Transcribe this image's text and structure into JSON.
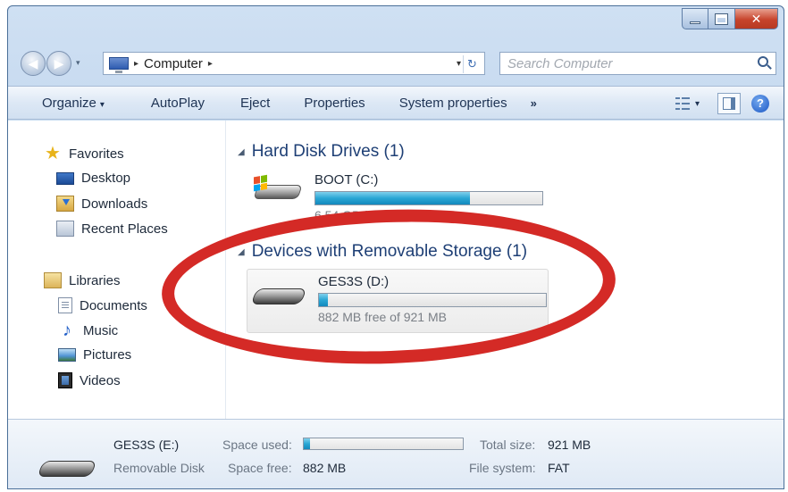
{
  "window": {
    "caption_min": "–",
    "caption_max": "□",
    "caption_close": "✕"
  },
  "address_bar": {
    "separator": "▸",
    "location": "Computer",
    "trailing_separator": "▸",
    "dropdown_glyph": "▾",
    "refresh_glyph": "↻"
  },
  "search": {
    "placeholder": "Search Computer"
  },
  "toolbar": {
    "organize": "Organize",
    "autoplay": "AutoPlay",
    "eject": "Eject",
    "properties": "Properties",
    "system_properties": "System properties",
    "more": "»",
    "dropdown_glyph": "▾",
    "help": "?"
  },
  "sidebar": {
    "favorites": "Favorites",
    "desktop": "Desktop",
    "downloads": "Downloads",
    "recent_places": "Recent Places",
    "libraries": "Libraries",
    "documents": "Documents",
    "music": "Music",
    "pictures": "Pictures",
    "videos": "Videos"
  },
  "main": {
    "hdd_group": "Hard Disk Drives (1)",
    "removable_group": "Devices with Removable Storage (1)",
    "collapse_glyph": "◢",
    "drives": [
      {
        "name": "BOOT (C:)",
        "free_text": "6.54 GB free of 20.2 GB",
        "used_fraction": 0.68
      },
      {
        "name": "GES3S (D:)",
        "free_text": "882 MB free of 921 MB",
        "used_fraction": 0.04
      }
    ]
  },
  "details": {
    "drive_name": "GES3S (E:)",
    "drive_type": "Removable Disk",
    "space_used_label": "Space used:",
    "space_free_label": "Space free:",
    "space_free_value": "882 MB",
    "total_size_label": "Total size:",
    "total_size_value": "921 MB",
    "file_system_label": "File system:",
    "file_system_value": "FAT",
    "used_fraction": 0.04
  },
  "colors": {
    "annotation": "#d42a26",
    "progress": "#2aa6d4"
  }
}
